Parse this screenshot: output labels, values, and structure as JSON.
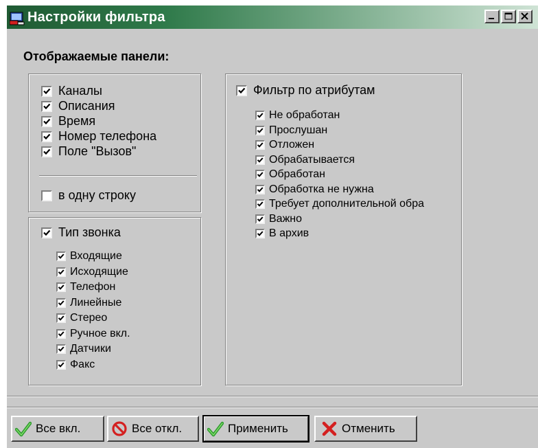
{
  "window": {
    "title": "Настройки фильтра"
  },
  "section_label": "Отображаемые панели:",
  "panels": {
    "items": [
      {
        "label": "Каналы",
        "checked": true
      },
      {
        "label": "Описания",
        "checked": true
      },
      {
        "label": "Время",
        "checked": true
      },
      {
        "label": "Номер телефона",
        "checked": true
      },
      {
        "label": "Поле \"Вызов\"",
        "checked": true
      }
    ],
    "one_line": {
      "label": "в одну строку",
      "checked": false
    }
  },
  "call_type": {
    "label": "Тип звонка",
    "checked": true,
    "items": [
      {
        "label": "Входящие",
        "checked": true
      },
      {
        "label": "Исходящие",
        "checked": true
      },
      {
        "label": "Телефон",
        "checked": true
      },
      {
        "label": "Линейные",
        "checked": true
      },
      {
        "label": "Стерео",
        "checked": true
      },
      {
        "label": "Ручное вкл.",
        "checked": true
      },
      {
        "label": "Датчики",
        "checked": true
      },
      {
        "label": "Факс",
        "checked": true
      }
    ]
  },
  "attribute_filter": {
    "label": "Фильтр по атрибутам",
    "checked": true,
    "items": [
      {
        "label": "Не обработан",
        "checked": true
      },
      {
        "label": "Прослушан",
        "checked": true
      },
      {
        "label": "Отложен",
        "checked": true
      },
      {
        "label": "Обрабатывается",
        "checked": true
      },
      {
        "label": "Обработан",
        "checked": true
      },
      {
        "label": "Обработка не нужна",
        "checked": true
      },
      {
        "label": "Требует дополнительной обра",
        "checked": true
      },
      {
        "label": "Важно",
        "checked": true
      },
      {
        "label": "В архив",
        "checked": true
      }
    ]
  },
  "buttons": {
    "all_on": {
      "label": "Все вкл.",
      "icon": "green-check-icon"
    },
    "all_off": {
      "label": "Все откл.",
      "icon": "no-entry-icon"
    },
    "apply": {
      "label": "Применить",
      "icon": "green-check-icon"
    },
    "cancel": {
      "label": "Отменить",
      "icon": "red-x-icon"
    }
  },
  "colors": {
    "titlebar_start": "#1f5a33",
    "titlebar_end": "#cfe3d5",
    "dialog_bg": "#c9c9c9",
    "check_green": "#2e9a2e",
    "cancel_red": "#d42020"
  }
}
